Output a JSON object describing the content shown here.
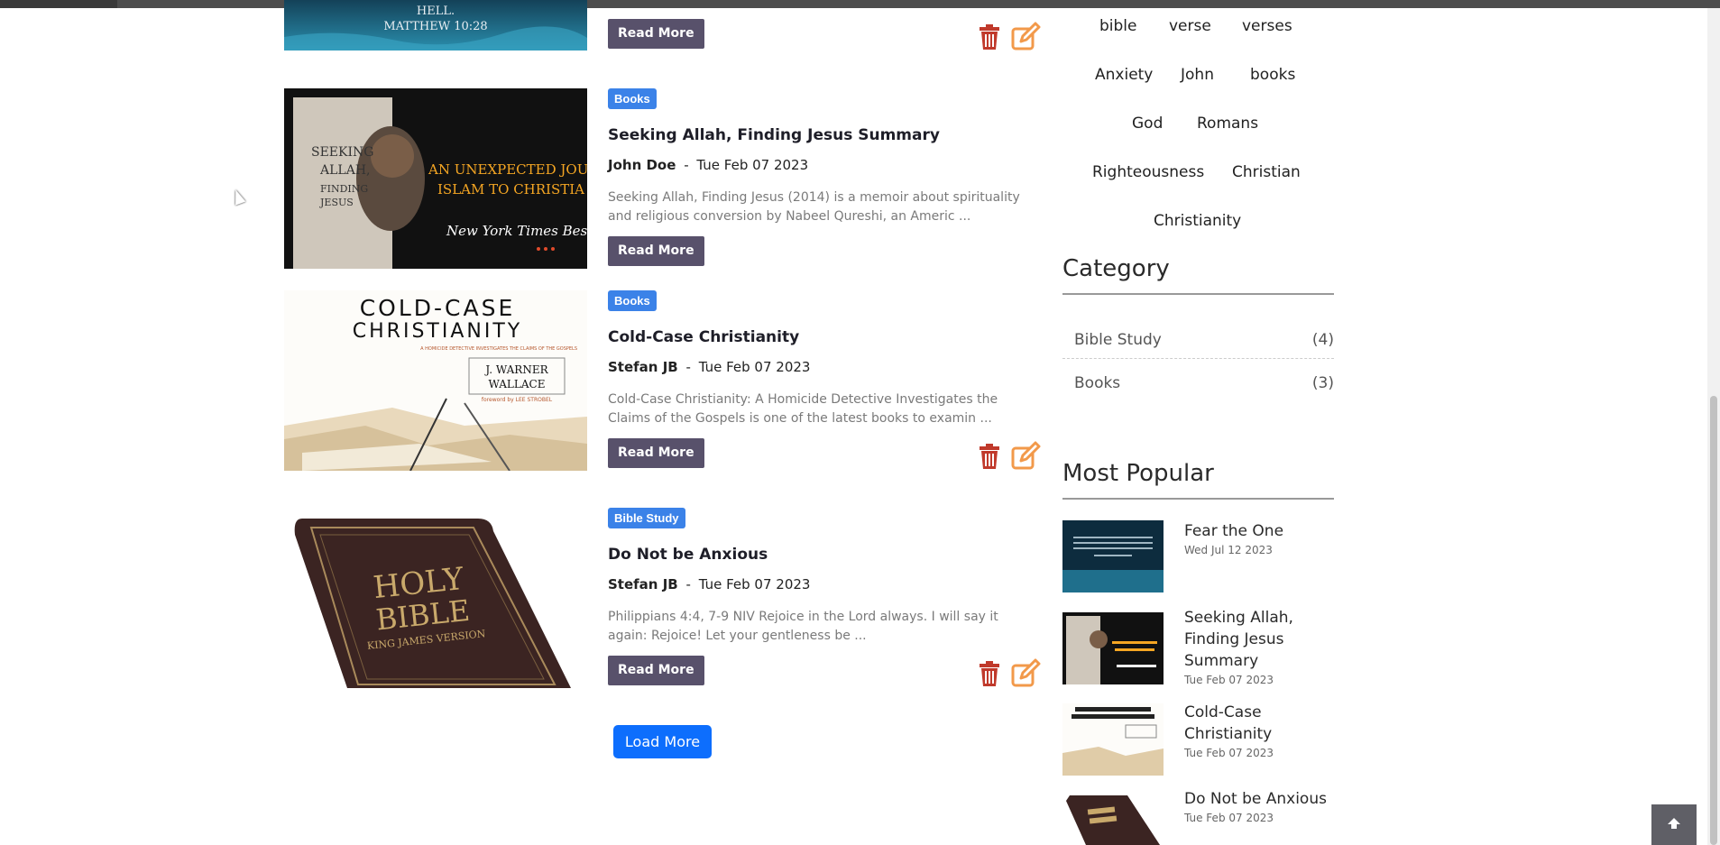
{
  "colors": {
    "accent": "#0d6efd",
    "badge": "#3b82e8",
    "read_more": "#58516b",
    "delete_icon": "#c0392b",
    "edit_icon": "#f2994a"
  },
  "posts": [
    {
      "thumb_caption_1": "HELL.",
      "thumb_caption_2": "MATTHEW 10:28",
      "read_more": "Read More",
      "icons": [
        "trash-icon",
        "edit-icon"
      ]
    },
    {
      "category": "Books",
      "title": "Seeking Allah, Finding Jesus Summary",
      "author": "John Doe",
      "separator": "-",
      "date": "Tue Feb 07 2023",
      "excerpt": "Seeking Allah, Finding Jesus (2014) is a memoir about spirituality and religious conversion by Nabeel Qureshi, an Americ ...",
      "read_more": "Read More",
      "cover": {
        "line1": "SEEKING",
        "line2": "ALLAH,",
        "line3": "FINDING",
        "line4": "JESUS",
        "tag1": "AN UNEXPECTED JOURNEY",
        "tag2": "ISLAM TO CHRISTIA",
        "tag3": "New York Times Bes"
      }
    },
    {
      "category": "Books",
      "title": "Cold-Case Christianity",
      "author": "Stefan JB",
      "separator": "-",
      "date": "Tue Feb 07 2023",
      "excerpt": "Cold-Case Christianity: A Homicide Detective Investigates the Claims of the Gospels is one of the latest books to examin ...",
      "read_more": "Read More",
      "icons": [
        "trash-icon",
        "edit-icon"
      ],
      "cover": {
        "line1": "COLD-CASE",
        "line2": "CHRISTIANITY",
        "sub": "A HOMICIDE DETECTIVE INVESTIGATES THE CLAIMS OF THE GOSPELS",
        "author1": "J. WARNER",
        "author2": "WALLACE",
        "foreword": "foreword by LEE STROBEL"
      }
    },
    {
      "category": "Bible Study",
      "title": "Do Not be Anxious",
      "author": "Stefan JB",
      "separator": "-",
      "date": "Tue Feb 07 2023",
      "excerpt": "Philippians 4:4, 7-9 NIV Rejoice in the Lord always. I will say it again: Rejoice! Let your gentleness be ...",
      "read_more": "Read More",
      "icons": [
        "trash-icon",
        "edit-icon"
      ],
      "cover": {
        "line1": "HOLY",
        "line2": "BIBLE",
        "line3": "KING JAMES VERSION"
      }
    }
  ],
  "load_more": "Load More",
  "tags": [
    "bible",
    "verse",
    "verses",
    "Anxiety",
    "John",
    "books",
    "God",
    "Romans",
    "Righteousness",
    "Christian",
    "Christianity"
  ],
  "category": {
    "heading": "Category",
    "items": [
      {
        "name": "Bible Study",
        "count": "(4)"
      },
      {
        "name": "Books",
        "count": "(3)"
      }
    ]
  },
  "popular": {
    "heading": "Most Popular",
    "items": [
      {
        "title": "Fear the One",
        "date": "Wed Jul 12 2023"
      },
      {
        "title": "Seeking Allah, Finding Jesus Summary",
        "date": "Tue Feb 07 2023"
      },
      {
        "title": "Cold-Case Christianity",
        "date": "Tue Feb 07 2023"
      },
      {
        "title": "Do Not be Anxious",
        "date": "Tue Feb 07 2023"
      }
    ]
  },
  "back_to_top_icon": "arrow-up-icon"
}
